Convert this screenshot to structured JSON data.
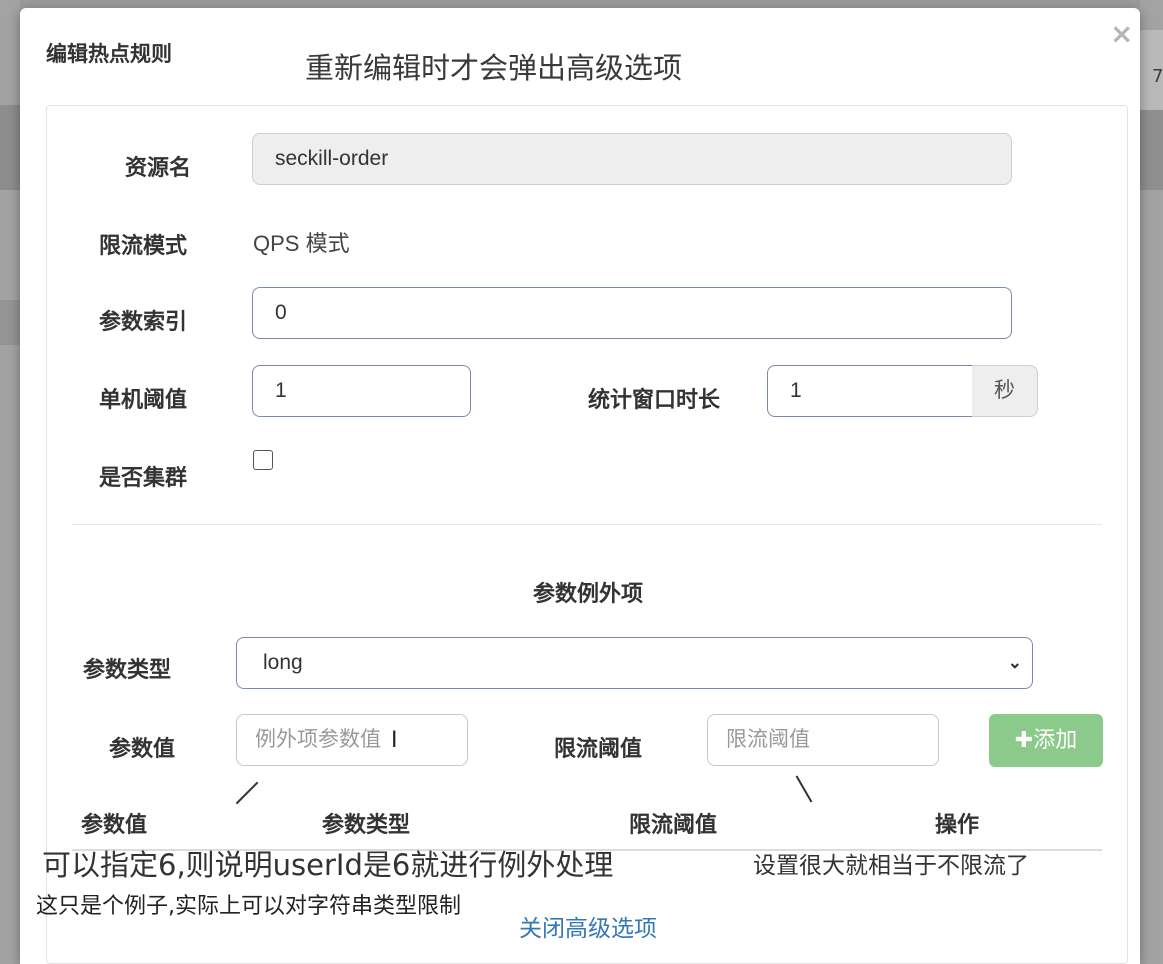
{
  "backdrop": {
    "edge_digit": "7"
  },
  "modal": {
    "title": "编辑热点规则",
    "close_glyph": "×",
    "annotation_top": "重新编辑时才会弹出高级选项"
  },
  "form": {
    "resource_label": "资源名",
    "resource_value": "seckill-order",
    "mode_label": "限流模式",
    "mode_value": "QPS 模式",
    "param_index_label": "参数索引",
    "param_index_value": "0",
    "threshold_label": "单机阈值",
    "threshold_value": "1",
    "window_label": "统计窗口时长",
    "window_value": "1",
    "window_unit": "秒",
    "cluster_label": "是否集群",
    "cluster_checked": false
  },
  "exceptions": {
    "section_title": "参数例外项",
    "param_type_label": "参数类型",
    "param_type_value": "long",
    "param_value_label": "参数值",
    "param_value_placeholder": "例外项参数值",
    "limit_label": "限流阈值",
    "limit_placeholder": "限流阈值",
    "add_label": "添加",
    "table_headers": [
      "参数值",
      "参数类型",
      "限流阈值",
      "操作"
    ]
  },
  "annotations": {
    "note1": "可以指定6,则说明userId是6就进行例外处理",
    "note2": "设置很大就相当于不限流了",
    "note3": "这只是个例子,实际上可以对字符串类型限制"
  },
  "footer": {
    "close_advanced_label": "关闭高级选项"
  },
  "colors": {
    "add_button": "#8cca8c",
    "link": "#3478b7",
    "input_border": "#7a8da8"
  }
}
